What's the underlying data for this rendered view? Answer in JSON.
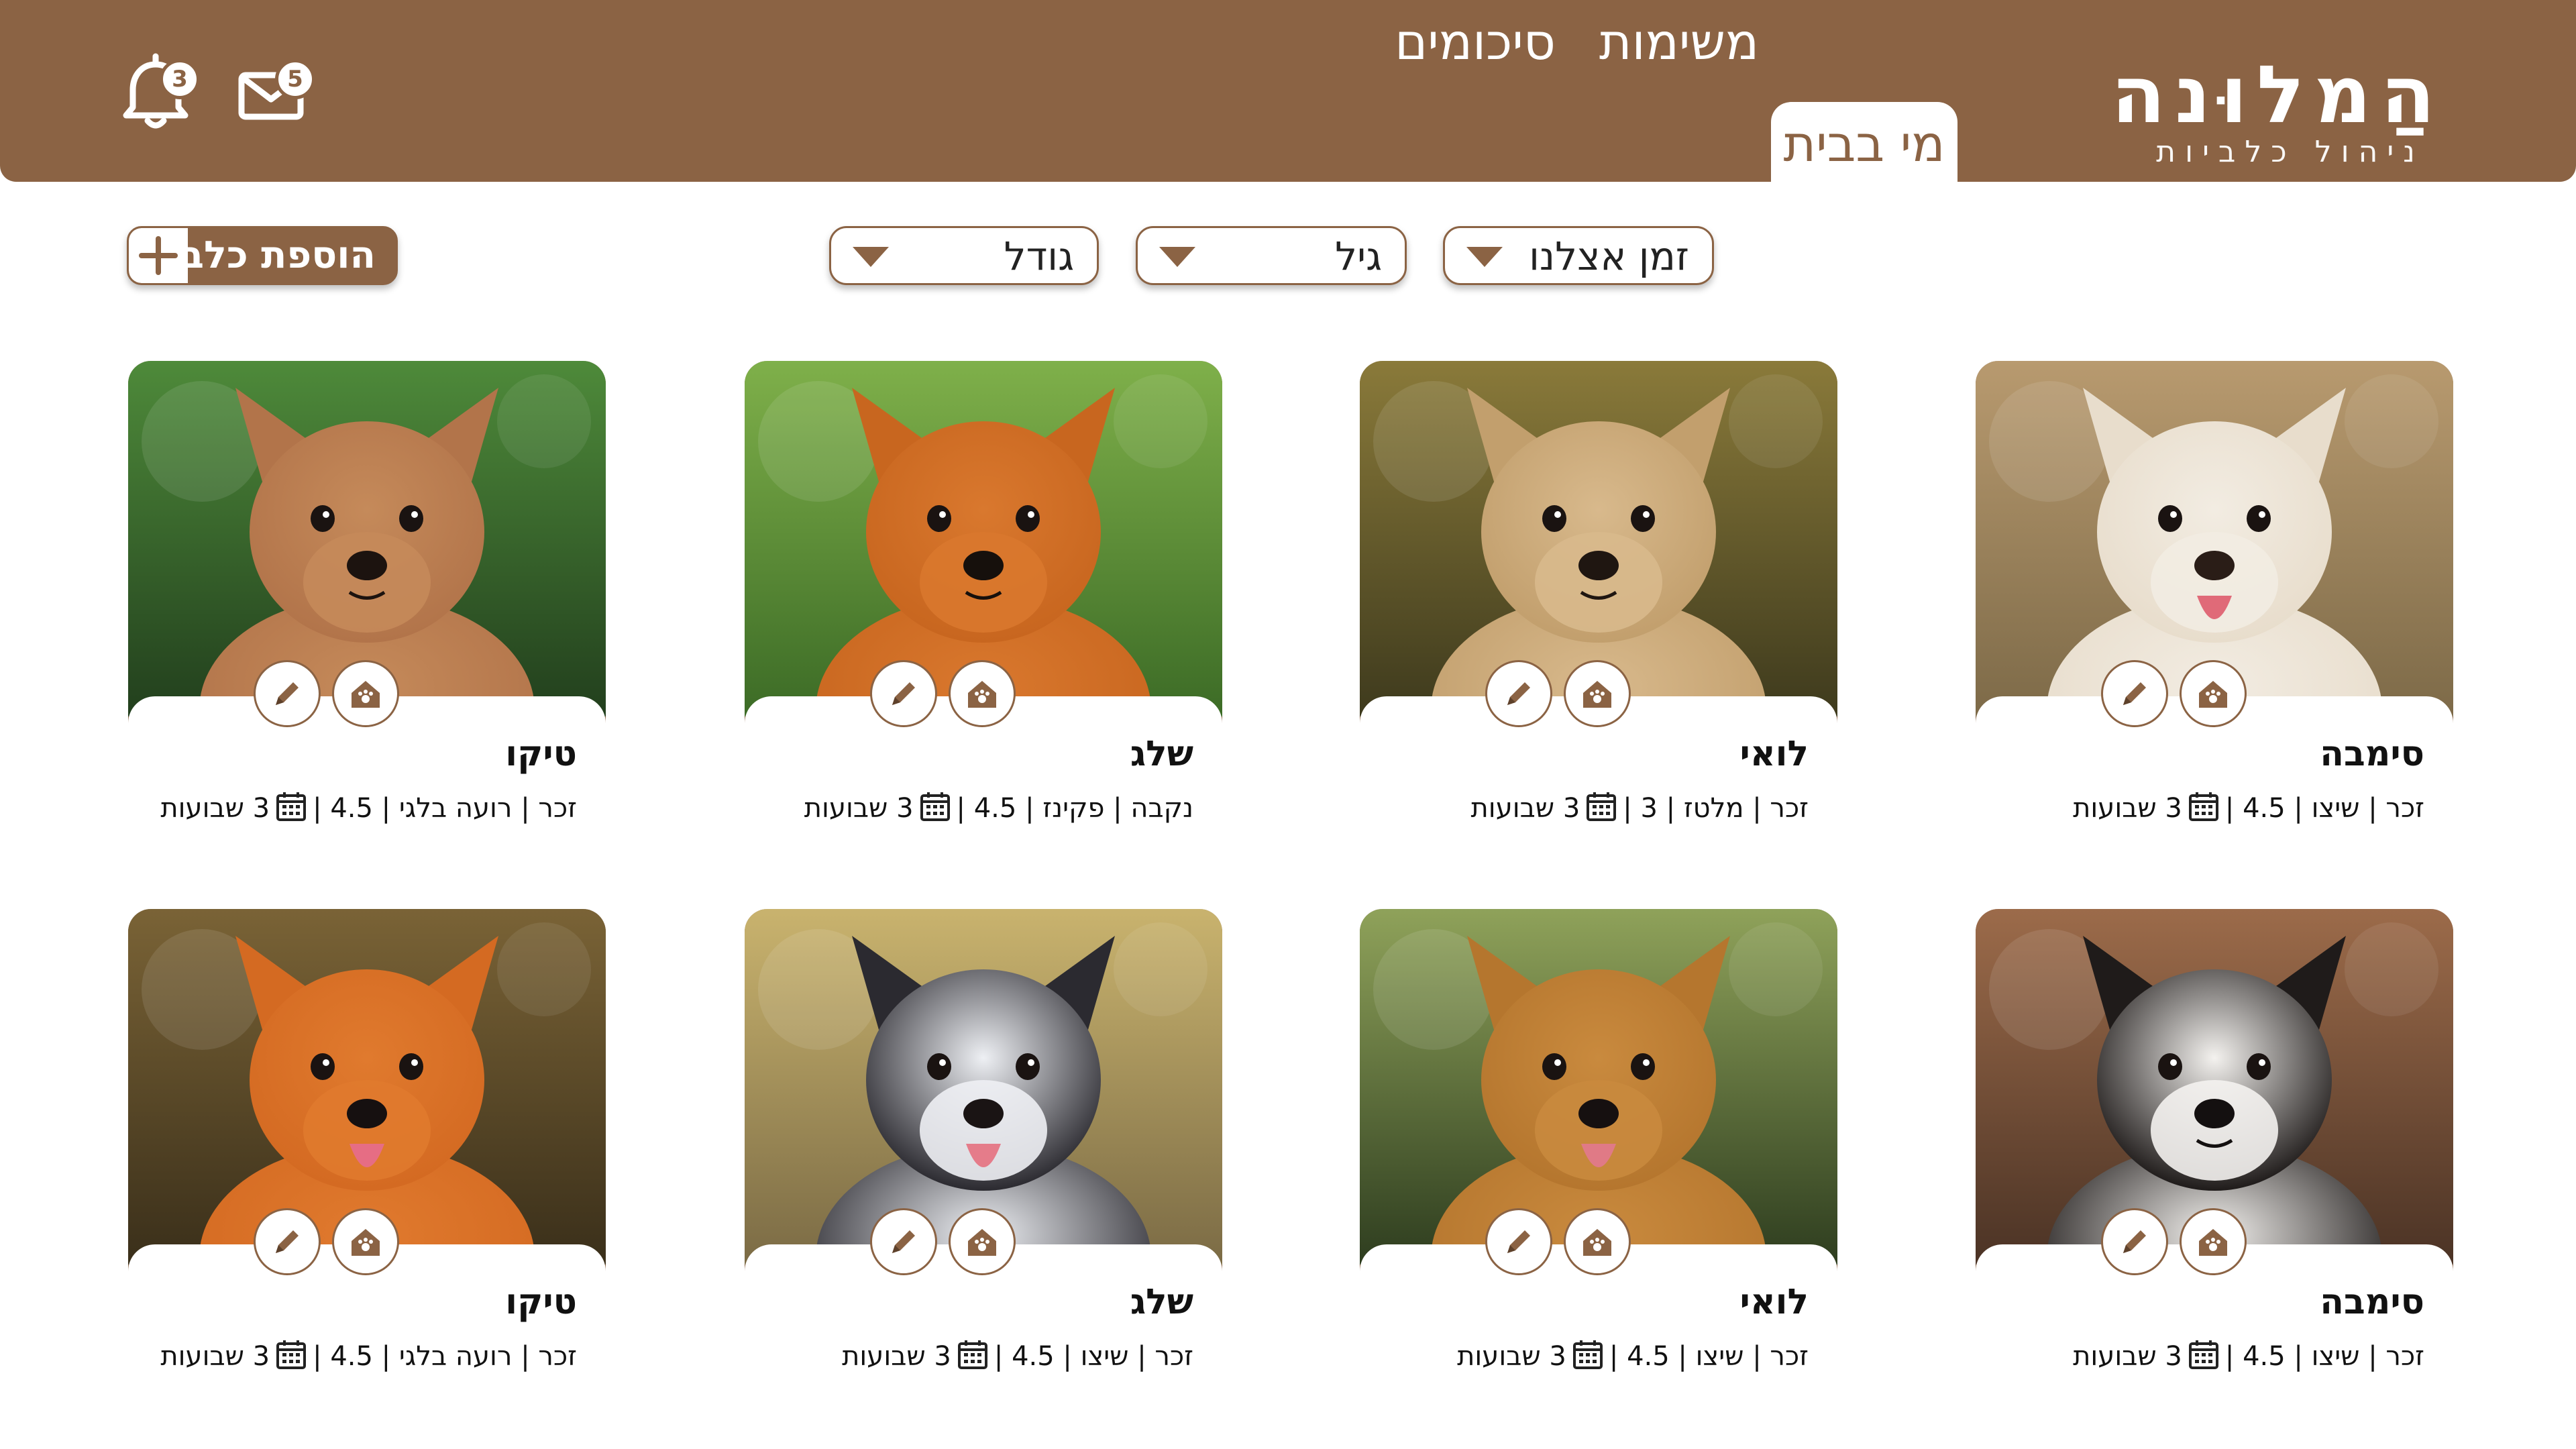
{
  "header": {
    "logo_title": "הַמלוּנה",
    "logo_subtitle": "ניהול כלביות",
    "tabs": [
      {
        "label": "מי בבית",
        "active": true
      },
      {
        "label": "משימות",
        "active": false
      },
      {
        "label": "סיכומים",
        "active": false
      }
    ],
    "notifications_icon": "bell-icon",
    "notifications_count": "3",
    "messages_icon": "envelope-icon",
    "messages_count": "5"
  },
  "filters": [
    {
      "label": "זמן אצלנו",
      "icon": "triangle-down-icon"
    },
    {
      "label": "גיל",
      "icon": "triangle-down-icon"
    },
    {
      "label": "גודל",
      "icon": "triangle-down-icon"
    }
  ],
  "add_button": {
    "label": "הוספת כלב",
    "icon": "plus-icon"
  },
  "dogs": [
    {
      "name": "סימבה",
      "details": "זכר | שיצו | 4.5 |",
      "stay": "3 שבועות"
    },
    {
      "name": "לואי",
      "details": "זכר | מלטז | 3 |",
      "stay": "3 שבועות"
    },
    {
      "name": "שלג",
      "details": "נקבה | פקינז | 4.5 |",
      "stay": "3 שבועות"
    },
    {
      "name": "טיקו",
      "details": "זכר | רועה בלגי | 4.5 |",
      "stay": "3 שבועות"
    },
    {
      "name": "סימבה",
      "details": "זכר | שיצו | 4.5 |",
      "stay": "3 שבועות"
    },
    {
      "name": "לואי",
      "details": "זכר | שיצו | 4.5 |",
      "stay": "3 שבועות"
    },
    {
      "name": "שלג",
      "details": "זכר | שיצו | 4.5 |",
      "stay": "3 שבועות"
    },
    {
      "name": "טיקו",
      "details": "זכר | רועה בלגי | 4.5 |",
      "stay": "3 שבועות"
    }
  ],
  "card_icons": {
    "home": "dog-house-icon",
    "edit": "pencil-icon",
    "calendar": "calendar-icon"
  },
  "colors": {
    "brand": "#8b6344",
    "background": "#ffffff"
  }
}
